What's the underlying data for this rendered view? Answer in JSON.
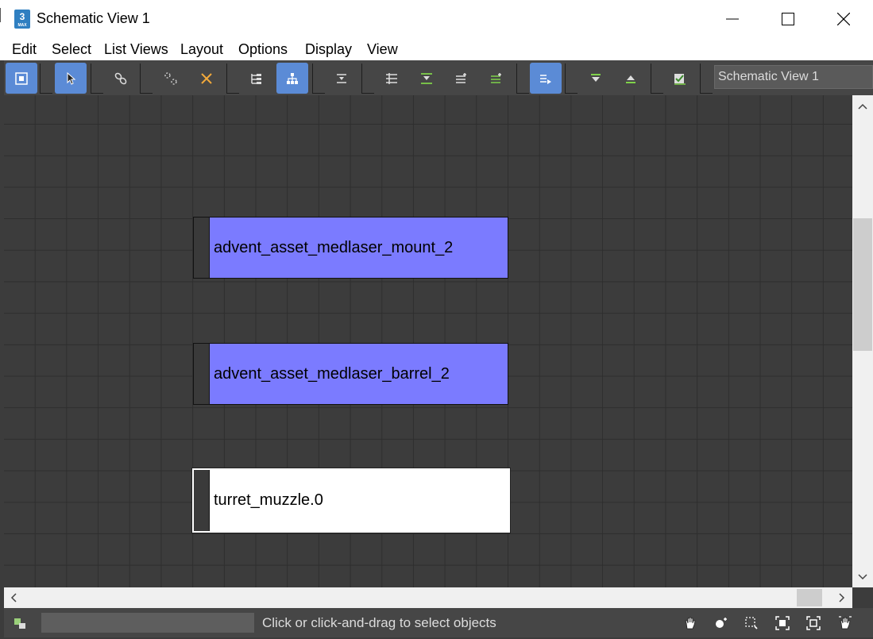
{
  "window": {
    "title": "Schematic View 1",
    "icon_text": "3",
    "icon_subtext": "MAX"
  },
  "menu": [
    "Edit",
    "Select",
    "List Views",
    "Layout",
    "Options",
    "Display",
    "View"
  ],
  "toolbar": {
    "name_field_value": "Schematic View 1",
    "accent_color": "#5b8bd6",
    "icon_green": "#7fd24a",
    "icon_orange": "#f2a93b"
  },
  "nodes": [
    {
      "label": "advent_asset_medlaser_mount_2",
      "color": "#7b7bff",
      "selected": false
    },
    {
      "label": "advent_asset_medlaser_barrel_2",
      "color": "#7b7bff",
      "selected": false
    },
    {
      "label": "turret_muzzle.0",
      "color": "#ffffff",
      "selected": true
    }
  ],
  "status": {
    "message": "Click or click-and-drag to select objects"
  }
}
